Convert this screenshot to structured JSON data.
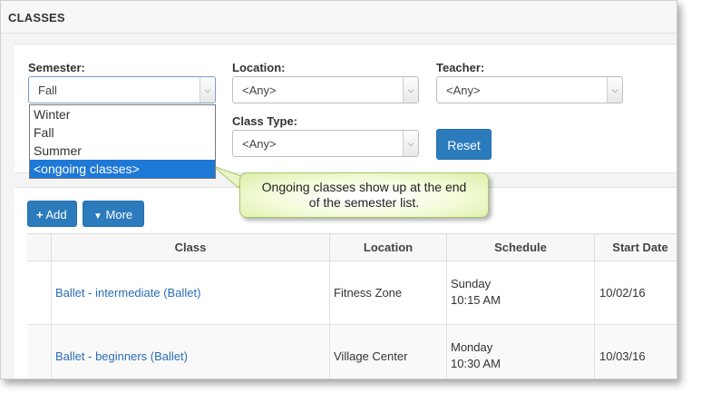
{
  "page": {
    "title": "CLASSES"
  },
  "filters": {
    "semester": {
      "label": "Semester:",
      "value": "Fall",
      "options": [
        "Winter",
        "Fall",
        "Summer",
        "<ongoing classes>"
      ],
      "highlighted_option": "<ongoing classes>"
    },
    "location": {
      "label": "Location:",
      "value": "<Any>"
    },
    "teacher": {
      "label": "Teacher:",
      "value": "<Any>"
    },
    "class_type": {
      "label": "Class Type:",
      "value": "<Any>"
    },
    "reset_label": "Reset"
  },
  "callout": {
    "line1": "Ongoing classes show up at the end",
    "line2": "of the semester list."
  },
  "toolbar": {
    "add_label": "Add",
    "more_label": "More"
  },
  "table": {
    "columns": [
      "Class",
      "Location",
      "Schedule",
      "Start Date"
    ],
    "rows": [
      {
        "class": "Ballet - intermediate (Ballet)",
        "location": "Fitness Zone",
        "day": "Sunday",
        "time": "10:15 AM",
        "start_date": "10/02/16"
      },
      {
        "class": "Ballet - beginners (Ballet)",
        "location": "Village Center",
        "day": "Monday",
        "time": "10:30 AM",
        "start_date": "10/03/16"
      }
    ]
  },
  "icons": {
    "dropdown_arrow": "chevron-down-icon",
    "add": "plus-icon",
    "more": "chevron-down-icon"
  },
  "colors": {
    "primary_button": "#2b7bbd",
    "link": "#2a6db2",
    "selected_option": "#1e78d6",
    "callout_fill": "#e8f5c0"
  }
}
